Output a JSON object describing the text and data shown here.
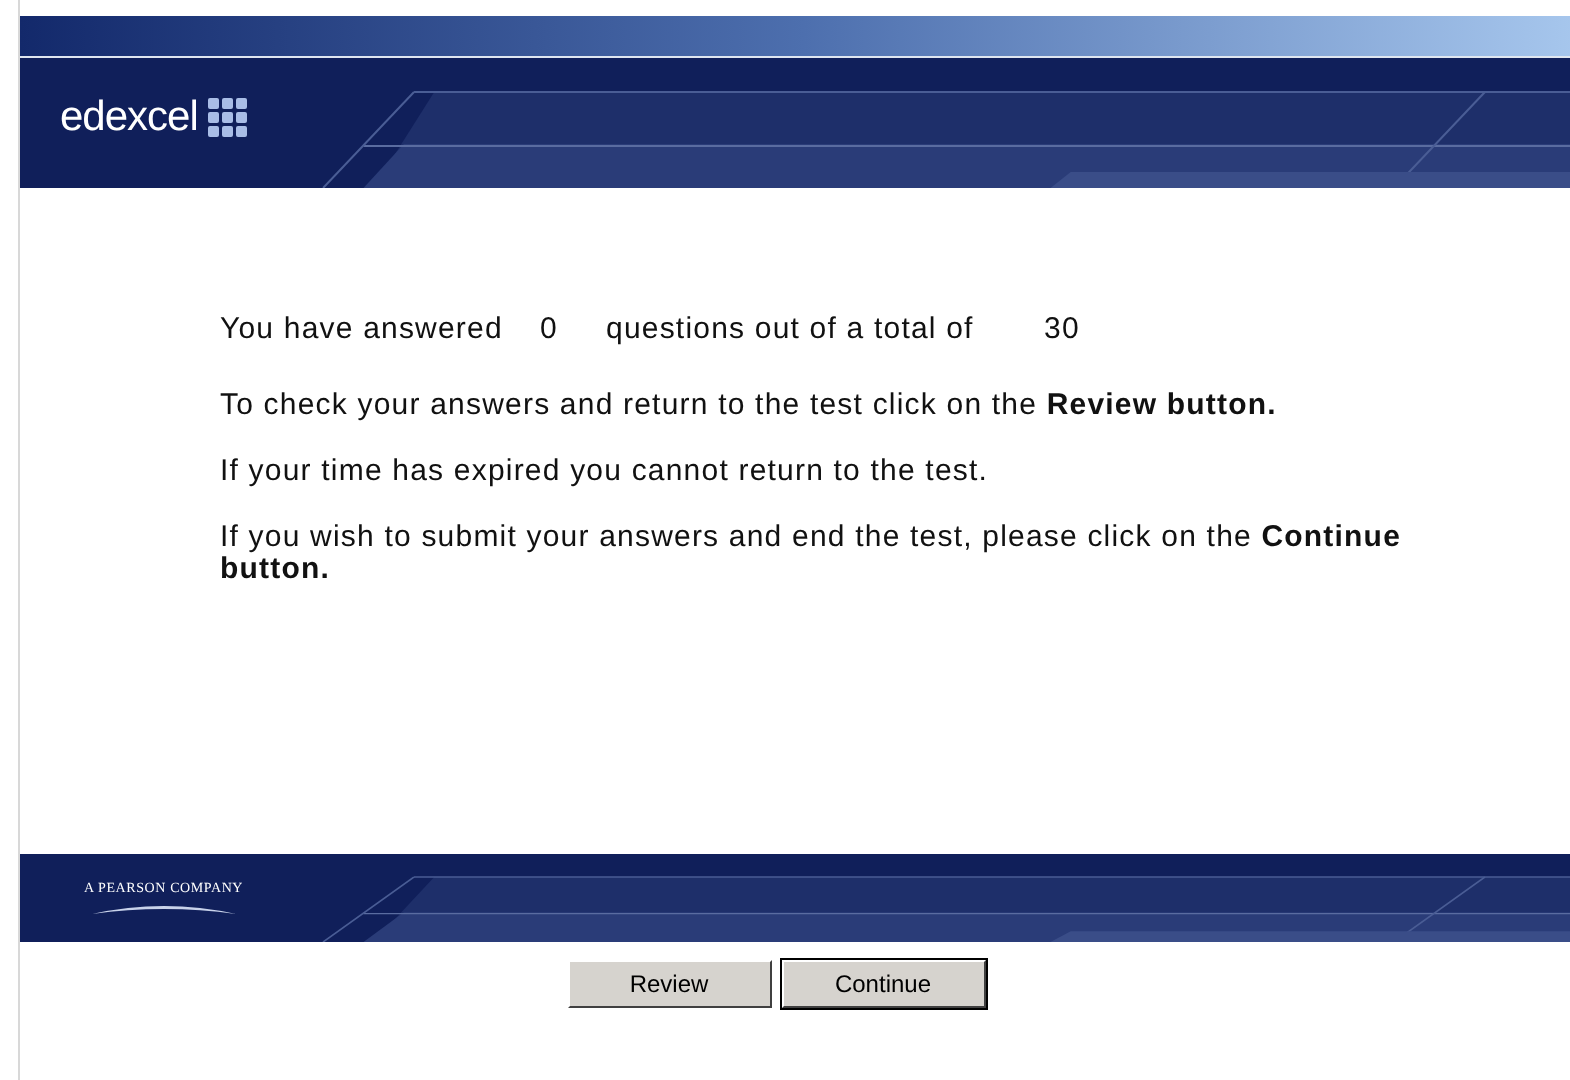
{
  "header": {
    "logo_text": "edexcel"
  },
  "summary": {
    "prefix": "You have answered",
    "answered": "0",
    "middle": "questions out of a total of",
    "total": "30"
  },
  "paragraphs": [
    "To check your answers and return to the test click on the **Review button.**",
    "If your time has expired you cannot return to the test.",
    "If you wish to submit your answers and end the test, please click on the **Continue button.**"
  ],
  "footer": {
    "company": "A PEARSON COMPANY"
  },
  "buttons": [
    {
      "label": "Review",
      "selected": false
    },
    {
      "label": "Continue",
      "selected": true
    }
  ]
}
